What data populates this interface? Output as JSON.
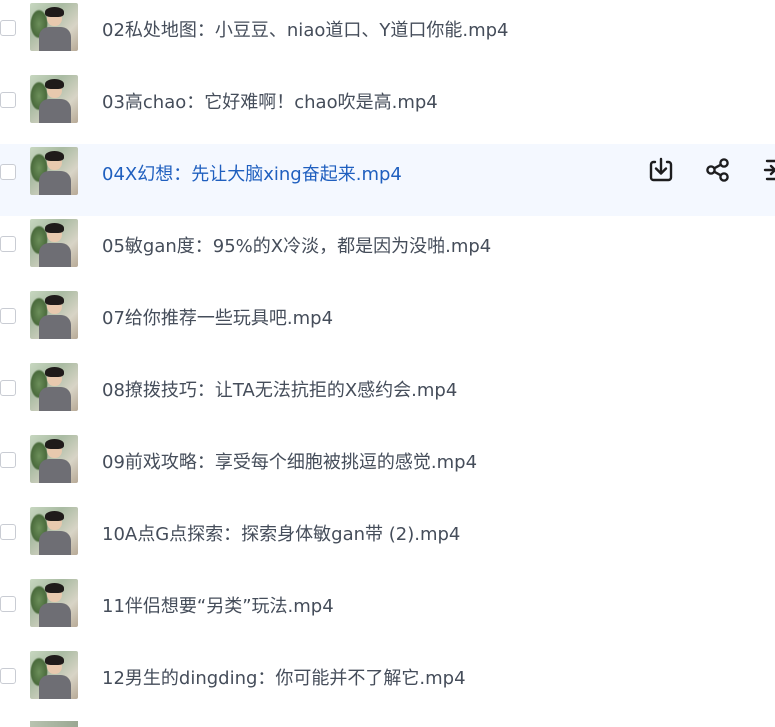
{
  "files": [
    {
      "name": "02私处地图：小豆豆、niao道口、Y道口你能.mp4"
    },
    {
      "name": "03高chao：它好难啊！chao吹是高.mp4"
    },
    {
      "name": "04X幻想：先让大脑xing奋起来.mp4",
      "highlighted": true
    },
    {
      "name": "05敏gan度：95%的X冷淡，都是因为没啪.mp4"
    },
    {
      "name": "07给你推荐一些玩具吧.mp4"
    },
    {
      "name": "08撩拨技巧：让TA无法抗拒的X感约会.mp4"
    },
    {
      "name": "09前戏攻略：享受每个细胞被挑逗的感觉.mp4"
    },
    {
      "name": "10A点G点探索：探索身体敏gan带 (2).mp4"
    },
    {
      "name": "11伴侣想要“另类”玩法.mp4"
    },
    {
      "name": "12男生的dingding：你可能并不了解它.mp4"
    }
  ],
  "row_actions": {
    "download_icon": "download-icon",
    "share_icon": "share-icon",
    "more_icon": "move-icon"
  },
  "colors": {
    "text": "#454d5a",
    "highlight_text": "#1f5fbf",
    "highlight_bg": "#f4f8ff",
    "icon": "#1d1d1f"
  }
}
